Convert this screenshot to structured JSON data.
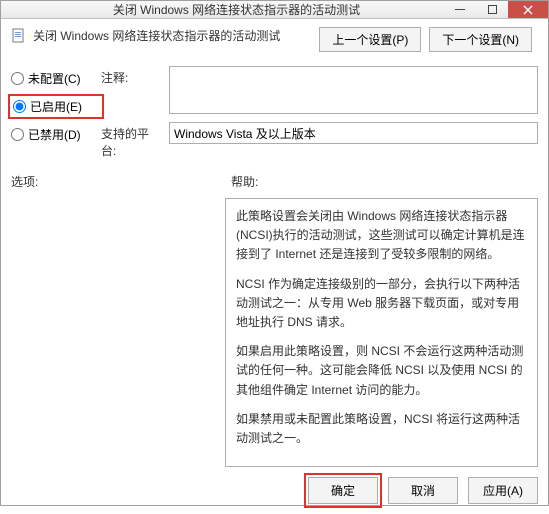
{
  "window": {
    "title": "关闭 Windows 网络连接状态指示器的活动测试"
  },
  "header": {
    "subtitle": "关闭 Windows 网络连接状态指示器的活动测试",
    "prev_btn": "上一个设置(P)",
    "next_btn": "下一个设置(N)"
  },
  "config": {
    "not_configured": "未配置(C)",
    "enabled": "已启用(E)",
    "disabled": "已禁用(D)",
    "comment_label": "注释:",
    "comment_value": "",
    "platform_label": "支持的平台:",
    "platform_value": "Windows Vista 及以上版本"
  },
  "labels": {
    "options": "选项:",
    "help": "帮助:"
  },
  "help": {
    "p1": "此策略设置会关闭由 Windows 网络连接状态指示器(NCSI)执行的活动测试，这些测试可以确定计算机是连接到了 Internet 还是连接到了受较多限制的网络。",
    "p2": "NCSI 作为确定连接级别的一部分，会执行以下两种活动测试之一：从专用 Web 服务器下载页面，或对专用地址执行 DNS 请求。",
    "p3": "如果启用此策略设置，则 NCSI 不会运行这两种活动测试的任何一种。这可能会降低 NCSI 以及使用 NCSI 的其他组件确定 Internet 访问的能力。",
    "p4": "如果禁用或未配置此策略设置，NCSI 将运行这两种活动测试之一。"
  },
  "footer": {
    "ok": "确定",
    "cancel": "取消",
    "apply": "应用(A)"
  }
}
